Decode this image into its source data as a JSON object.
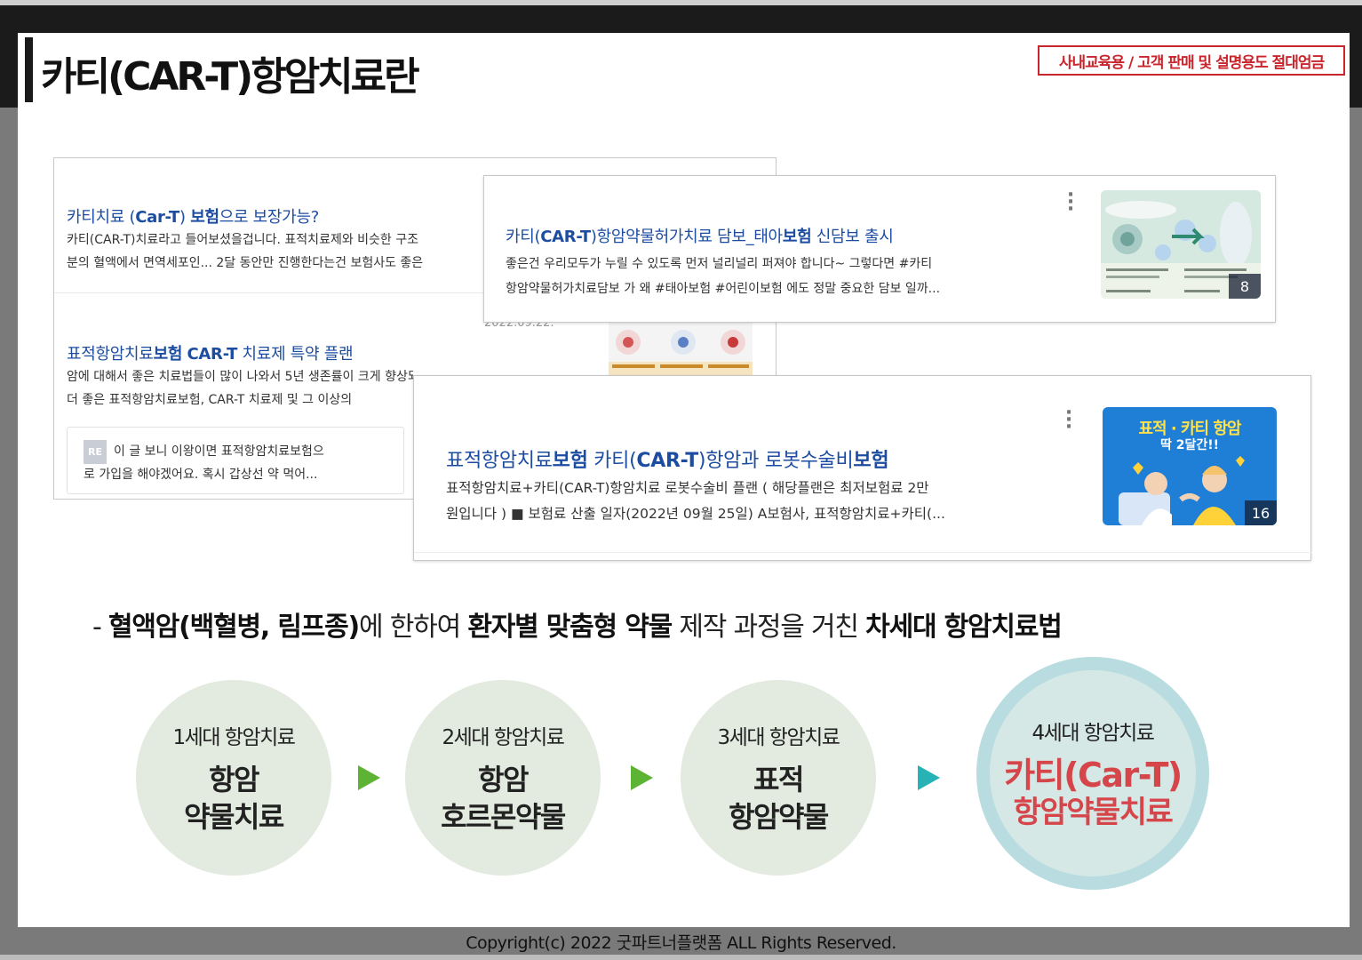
{
  "header": {
    "title": "카티(CAR-T)항암치료란",
    "notice": "사내교육용 / 고객 판매 및 설명용도 절대엄금"
  },
  "results": {
    "card_a": {
      "item1": {
        "title_parts": [
          "카티치료 (",
          "Car-T",
          ") ",
          "보험",
          "으로 보장가능?"
        ],
        "line1": "카티(CAR-T)치료라고 들어보셨을겁니다. 표적치료제와 비슷한 구조",
        "line2": "분의 혈액에서 면역세포인... 2달 동안만 진행한다는건 보험사도 좋은"
      },
      "item2": {
        "date": "2022.09.22.",
        "title_parts": [
          "표적항암치료",
          "보험",
          " ",
          "CAR-T",
          " 치료제 특약 플랜"
        ],
        "line1": "암에 대해서 좋은 치료법들이 많이 나와서 5년 생존률이 크게 향상되었지만 암으로",
        "line2": "더 좋은 표적항암치료보험, CAR-T 치료제 및 그 이상의"
      },
      "reply": {
        "tag": "RE",
        "line1": "이 글 보니 이왕이면 표적항암치료보험으",
        "line2": "로 가입을 해야겠어요. 혹시 갑상선 약 먹어..."
      }
    },
    "card_b": {
      "title_parts": [
        "카티(",
        "CAR-T",
        ")항암약물허가치료 담보_태아",
        "보험",
        " 신담보 출시"
      ],
      "line1": "좋은건 우리모두가 누릴 수 있도록 먼저 널리널리 퍼져야 합니다~ 그렇다면 #카티",
      "line2": "항암약물허가치료담보 가 왜 #태아보험 #어린이보험 에도 정말 중요한 담보 일까...",
      "thumb_count": "8",
      "more_icon": "more-vertical-icon"
    },
    "card_c": {
      "title_parts": [
        "표적항암치료",
        "보험",
        " 카티(",
        "CAR-T",
        ")항암과 로봇수술비",
        "보험"
      ],
      "line1": "표적항암치료+카티(CAR-T)항암치료 로봇수술비 플랜 ( 해당플랜은 최저보험료 2만",
      "line2": "원입니다 ) ■ 보험료 산출 일자(2022년 09월 25일) A보험사, 표적항암치료+카티(...",
      "thumb_line1": "표적 · 카티 항암",
      "thumb_line2": "딱 2달간!!",
      "thumb_count": "16",
      "more_icon": "more-vertical-icon"
    }
  },
  "summary": {
    "parts": [
      "- ",
      "혈액암(백혈병, 림프종)",
      "에 한하여 ",
      "환자별 맞춤형 약물",
      " 제작 과정을 거친 ",
      "차세대 항암치료법"
    ]
  },
  "generations": [
    {
      "label": "1세대 항암치료",
      "name1": "항암",
      "name2": "약물치료"
    },
    {
      "label": "2세대 항암치료",
      "name1": "항암",
      "name2": "호르몬약물"
    },
    {
      "label": "3세대 항암치료",
      "name1": "표적",
      "name2": "항암약물"
    },
    {
      "label": "4세대 항암치료",
      "name1": "카티(Car-T)",
      "name2": "항암약물치료"
    }
  ],
  "colors": {
    "accent_red": "#c8252c",
    "link_blue": "#1c4da1",
    "arrow_green": "#5db334",
    "arrow_teal": "#27b3b6",
    "gen4_text": "#d6454a"
  },
  "footer": {
    "copyright": "Copyright(c) 2022 굿파트너플랫폼 ALL Rights Reserved."
  }
}
